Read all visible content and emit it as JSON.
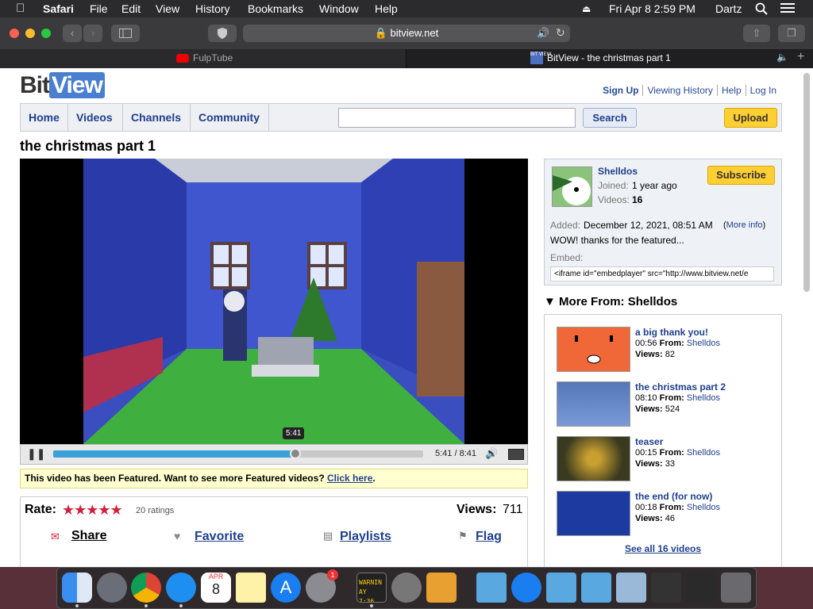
{
  "menubar": {
    "app": "Safari",
    "items": [
      "File",
      "Edit",
      "View",
      "History",
      "Bookmarks",
      "Window",
      "Help"
    ],
    "datetime": "Fri Apr 8  2:59 PM",
    "user": "Dartz"
  },
  "browser": {
    "url": "bitview.net",
    "tabs": [
      {
        "title": "FulpTube"
      },
      {
        "title": "BitView - the christmas part 1"
      }
    ]
  },
  "site": {
    "logo_bit": "Bit",
    "logo_view": "View",
    "top_links": [
      "Sign Up",
      "Viewing History",
      "Help",
      "Log In"
    ],
    "nav": [
      "Home",
      "Videos",
      "Channels",
      "Community"
    ],
    "search_button": "Search",
    "upload_button": "Upload"
  },
  "video": {
    "title": "the christmas part 1",
    "tooltip_time": "5:41",
    "time_display": "5:41 / 8:41",
    "progress": 0.655,
    "featured_text": "This video has been Featured. Want to see more Featured videos?",
    "featured_link": "Click here",
    "featured_period": ".",
    "rate_label": "Rate:",
    "rating_stars": 4.5,
    "ratings_count": "20 ratings",
    "views_label": "Views:",
    "views": "711",
    "actions": [
      "Share",
      "Favorite",
      "Playlists",
      "Flag"
    ]
  },
  "uploader": {
    "name": "Shelldos",
    "joined_label": "Joined:",
    "joined": "1 year ago",
    "videos_label": "Videos:",
    "videos": "16",
    "subscribe": "Subscribe",
    "added_label": "Added:",
    "added": "December 12, 2021, 08:51 AM",
    "more_info": "More info",
    "description": "WOW! thanks for the featured...",
    "embed_label": "Embed:",
    "embed_code": "<iframe id=\"embedplayer\" src=\"http://www.bitview.net/e"
  },
  "more_from": {
    "heading": "More From: Shelldos",
    "from_label": "From:",
    "views_label": "Views:",
    "videos": [
      {
        "title": "a big thank you!",
        "duration": "00:56",
        "author": "Shelldos",
        "views": "82"
      },
      {
        "title": "the christmas part 2",
        "duration": "08:10",
        "author": "Shelldos",
        "views": "524"
      },
      {
        "title": "teaser",
        "duration": "00:15",
        "author": "Shelldos",
        "views": "33"
      },
      {
        "title": "the end (for now)",
        "duration": "00:18",
        "author": "Shelldos",
        "views": "46"
      }
    ],
    "see_all": "See all 16 videos"
  },
  "dock": {
    "calendar_month": "APR",
    "calendar_day": "8",
    "badge": "1",
    "terminal_text": "WARNIN AY 7:36"
  }
}
